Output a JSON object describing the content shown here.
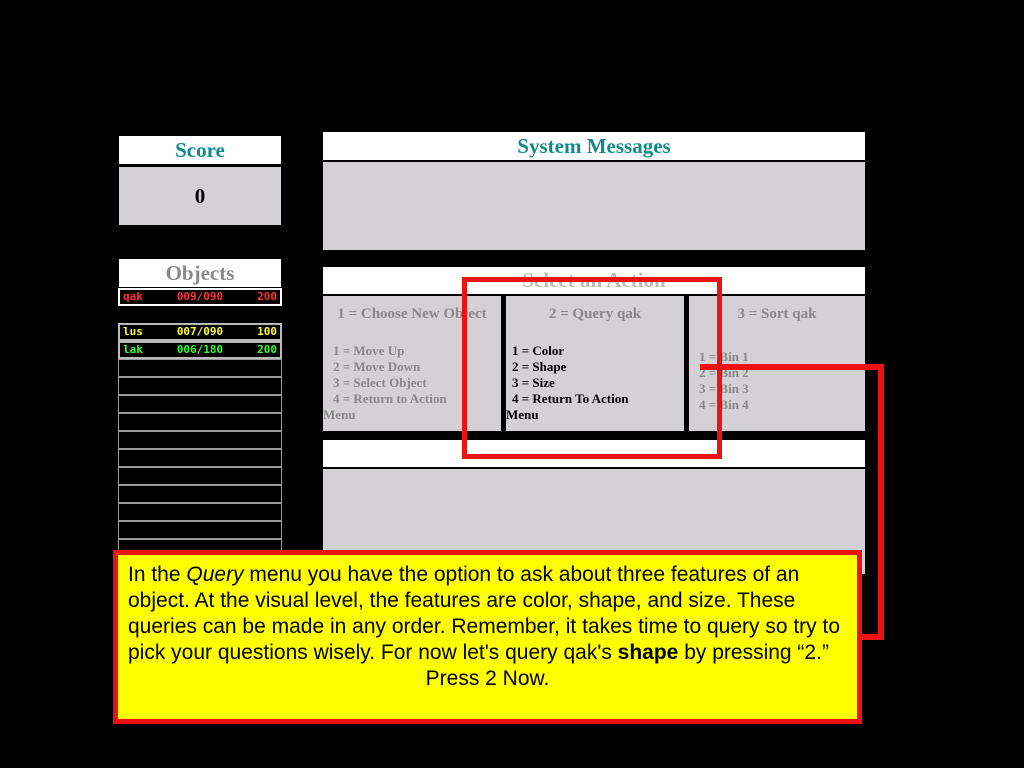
{
  "score": {
    "title": "Score",
    "value": "0"
  },
  "objects": {
    "title": "Objects",
    "selected": {
      "name": "qak",
      "coords": "009/090",
      "points": "200",
      "color": "#ff3333"
    },
    "list": [
      {
        "name": "lus",
        "coords": "007/090",
        "points": "100",
        "color": "#ffff33"
      },
      {
        "name": "lak",
        "coords": "006/180",
        "points": "200",
        "color": "#33ff33"
      }
    ]
  },
  "system_messages": {
    "title": "System Messages"
  },
  "action_panel": {
    "title": "Select an Action",
    "col1": {
      "heading": "1 = Choose New Object",
      "items": [
        "1 = Move Up",
        "2 = Move Down",
        "3 = Select Object",
        "4 = Return to Action"
      ],
      "wrap": "Menu"
    },
    "col2": {
      "heading": "2 = Query qak",
      "items": [
        "1 = Color",
        "2 = Shape",
        "3 = Size",
        "4 = Return To Action"
      ],
      "wrap": "Menu"
    },
    "col3": {
      "heading": "3 = Sort qak",
      "items": [
        "1 = Bin 1",
        "2 = Bin 2",
        "3 = Bin 3",
        "4 = Bin 4"
      ]
    }
  },
  "tutorial": {
    "p1_before": "In the ",
    "p1_italic": "Query",
    "p1_after": " menu you have the option to ask about three features of an object. At the visual level, the features are color, shape, and size. These queries can be made in any order.  Remember, it takes time to query so try to pick your questions wisely. For now let's query qak's ",
    "p1_bold": "shape",
    "p1_end": " by pressing “2.”",
    "prompt": "Press 2 Now."
  },
  "colors": {
    "accent_teal": "#138a8a",
    "highlight_red": "#ee1111",
    "tutorial_bg": "#ffff00"
  }
}
